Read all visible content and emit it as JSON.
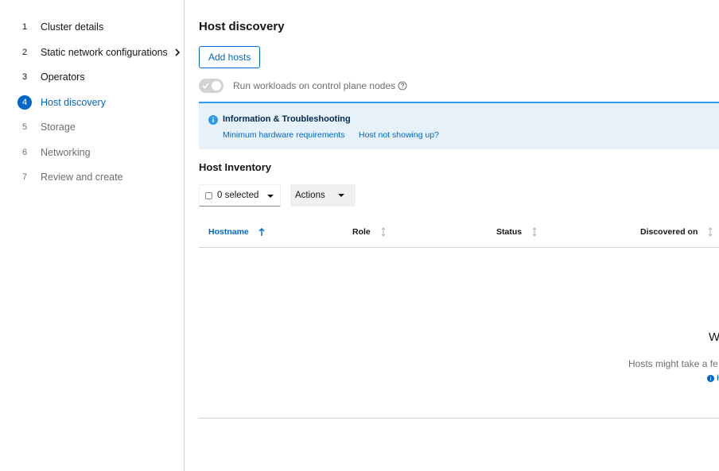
{
  "wizard": {
    "steps": [
      {
        "num": "1",
        "label": "Cluster details"
      },
      {
        "num": "2",
        "label": "Static network configurations"
      },
      {
        "num": "3",
        "label": "Operators"
      },
      {
        "num": "4",
        "label": "Host discovery"
      },
      {
        "num": "5",
        "label": "Storage"
      },
      {
        "num": "6",
        "label": "Networking"
      },
      {
        "num": "7",
        "label": "Review and create"
      }
    ],
    "active_step": "4",
    "icons": {
      "expand": "chevron-right-icon"
    }
  },
  "main": {
    "title": "Host discovery",
    "add_hosts_label": "Add hosts",
    "toggle": {
      "label": "Run workloads on control plane nodes",
      "checked": false,
      "help_icon": "question-circle-icon"
    },
    "alert": {
      "icon": "info-circle-icon",
      "title": "Information & Troubleshooting",
      "links": [
        "Minimum hardware requirements",
        "Host not showing up?"
      ]
    },
    "inventory": {
      "title": "Host Inventory",
      "bulk_select_label": "0 selected",
      "actions_label": "Actions",
      "columns": [
        {
          "label": "Hostname",
          "sorted": "ascending"
        },
        {
          "label": "Role"
        },
        {
          "label": "Status"
        },
        {
          "label": "Discovered on"
        }
      ],
      "empty_state": {
        "title_visible": "W",
        "body_visible": "Hosts might take a fe",
        "link_visible": "H"
      }
    }
  },
  "colors": {
    "accent": "#0066cc",
    "alert_bg": "#e7f1fa",
    "alert_border": "#2b9af3",
    "muted_text": "#6a6e73",
    "border": "#d2d2d2"
  }
}
